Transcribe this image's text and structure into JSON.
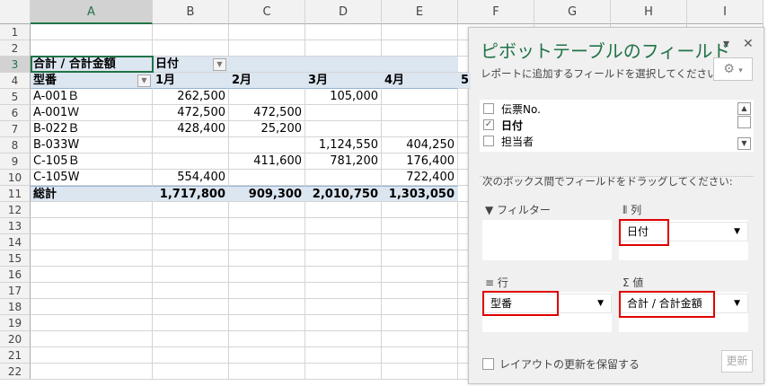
{
  "columns": [
    "A",
    "B",
    "C",
    "D",
    "E",
    "F",
    "G",
    "H",
    "I"
  ],
  "row_count": 22,
  "pivot": {
    "value_label": "合計 / 合計金額",
    "col_field": "日付",
    "row_field": "型番",
    "months": [
      "1月",
      "2月",
      "3月",
      "4月",
      "5"
    ],
    "rows": [
      {
        "label": "A-001Ｂ",
        "values": [
          "262,500",
          "",
          "105,000",
          ""
        ]
      },
      {
        "label": "A-001Ｗ",
        "values": [
          "472,500",
          "472,500",
          "",
          ""
        ]
      },
      {
        "label": "B-022Ｂ",
        "values": [
          "428,400",
          "25,200",
          "",
          ""
        ]
      },
      {
        "label": "B-033W",
        "values": [
          "",
          "",
          "1,124,550",
          "404,250"
        ]
      },
      {
        "label": "C-105Ｂ",
        "values": [
          "",
          "411,600",
          "781,200",
          "176,400"
        ]
      },
      {
        "label": "C-105W",
        "values": [
          "554,400",
          "",
          "",
          "722,400"
        ]
      }
    ],
    "total_label": "総計",
    "totals": [
      "1,717,800",
      "909,300",
      "2,010,750",
      "1,303,050"
    ]
  },
  "panel": {
    "title": "ピボットテーブルのフィールド",
    "choose_text": "レポートに追加するフィールドを選択してください:",
    "fields": [
      {
        "label": "伝票No.",
        "checked": false
      },
      {
        "label": "日付",
        "checked": true
      },
      {
        "label": "担当者",
        "checked": false
      }
    ],
    "drag_text": "次のボックス間でフィールドをドラッグしてください:",
    "filter_label": "フィルター",
    "columns_label": "列",
    "rows_label": "行",
    "values_label": "値",
    "columns_item": "日付",
    "rows_item": "型番",
    "values_item": "合計 / 合計金額",
    "defer_label": "レイアウトの更新を保留する",
    "update_button": "更新"
  }
}
